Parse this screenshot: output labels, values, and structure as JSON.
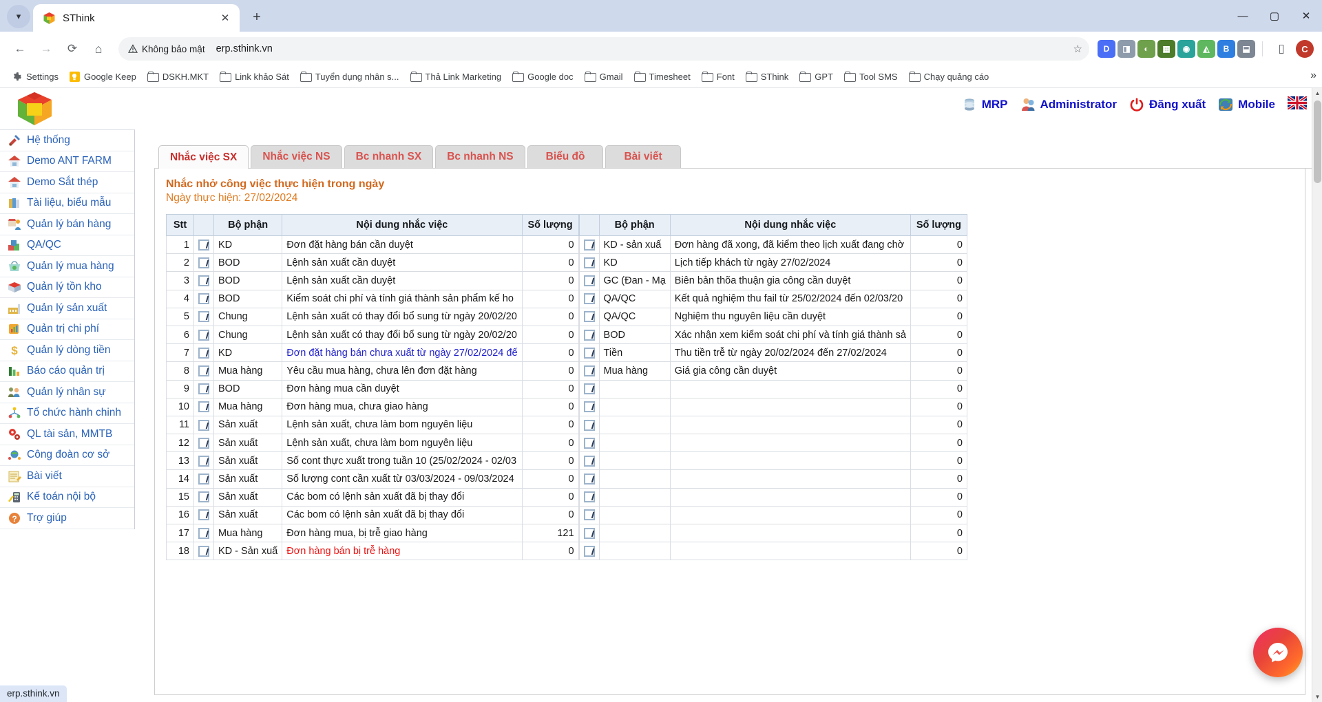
{
  "browser": {
    "tab": {
      "title": "SThink",
      "favicon": "sthink-logo-icon",
      "close": "✕"
    },
    "new_tab_label": "+",
    "window_controls": {
      "minimize": "—",
      "maximize": "▢",
      "close": "✕"
    },
    "nav": {
      "back": "←",
      "forward": "→",
      "reload": "⟳",
      "home": "⌂"
    },
    "omnibox": {
      "security_label": "Không bảo mật",
      "security_icon": "warning-triangle-icon",
      "url": "erp.sthink.vn",
      "star_icon": "☆"
    },
    "extensions": [
      "D",
      "◨",
      "◐",
      "▦",
      "◉",
      "◭",
      "B",
      "⬓"
    ],
    "split_icon": "▯",
    "profile_initial": "C",
    "bookmarks": [
      {
        "label": "Settings",
        "icon": "gear-icon"
      },
      {
        "label": "Google Keep",
        "icon": "keep-icon"
      },
      {
        "label": "DSKH.MKT",
        "icon": "folder-icon"
      },
      {
        "label": "Link khảo Sát",
        "icon": "folder-icon"
      },
      {
        "label": "Tuyển dụng nhân s...",
        "icon": "folder-icon"
      },
      {
        "label": "Thả Link Marketing",
        "icon": "folder-icon"
      },
      {
        "label": "Google doc",
        "icon": "folder-icon"
      },
      {
        "label": "Gmail",
        "icon": "folder-icon"
      },
      {
        "label": "Timesheet",
        "icon": "folder-icon"
      },
      {
        "label": "Font",
        "icon": "folder-icon"
      },
      {
        "label": "SThink",
        "icon": "folder-icon"
      },
      {
        "label": "GPT",
        "icon": "folder-icon"
      },
      {
        "label": "Tool SMS",
        "icon": "folder-icon"
      },
      {
        "label": "Chạy quảng cáo",
        "icon": "folder-icon"
      }
    ],
    "bookmarks_overflow": "»",
    "status_url": "erp.sthink.vn"
  },
  "erp": {
    "header_links": [
      {
        "label": "MRP",
        "icon": "database-icon"
      },
      {
        "label": "Administrator",
        "icon": "user-icon"
      },
      {
        "label": "Đăng xuất",
        "icon": "power-icon"
      },
      {
        "label": "Mobile",
        "icon": "sync-mobile-icon"
      }
    ],
    "language_flag": "uk-flag-icon",
    "sidebar": [
      {
        "label": "Hệ thống",
        "icon": "tools-icon"
      },
      {
        "label": "Demo ANT FARM",
        "icon": "house-icon"
      },
      {
        "label": "Demo Sắt thép",
        "icon": "house-icon"
      },
      {
        "label": "Tài liệu, biểu mẫu",
        "icon": "books-icon"
      },
      {
        "label": "Quản lý bán hàng",
        "icon": "shop-icon"
      },
      {
        "label": "QA/QC",
        "icon": "blocks-icon"
      },
      {
        "label": "Quản lý mua hàng",
        "icon": "basket-icon"
      },
      {
        "label": "Quản lý tồn kho",
        "icon": "box-icon"
      },
      {
        "label": "Quản lý sản xuất",
        "icon": "factory-icon"
      },
      {
        "label": "Quản trị chi phí",
        "icon": "chart-book-icon"
      },
      {
        "label": "Quản lý dòng tiền",
        "icon": "dollar-icon"
      },
      {
        "label": "Báo cáo quản trị",
        "icon": "bar-chart-icon"
      },
      {
        "label": "Quản lý nhân sự",
        "icon": "people-icon"
      },
      {
        "label": "Tổ chức hành chinh",
        "icon": "network-icon"
      },
      {
        "label": "QL tài sản, MMTB",
        "icon": "gears-icon"
      },
      {
        "label": "Công đoàn cơ sở",
        "icon": "union-icon"
      },
      {
        "label": "Bài viết",
        "icon": "note-icon"
      },
      {
        "label": "Kế toán nội bộ",
        "icon": "calculator-icon"
      },
      {
        "label": "Trợ giúp",
        "icon": "help-icon"
      }
    ],
    "tabs": [
      {
        "label": "Nhắc việc SX",
        "active": true
      },
      {
        "label": "Nhắc việc NS",
        "active": false
      },
      {
        "label": "Bc nhanh SX",
        "active": false
      },
      {
        "label": "Bc nhanh NS",
        "active": false
      },
      {
        "label": "Biểu đồ",
        "active": false
      },
      {
        "label": "Bài viết",
        "active": false
      }
    ],
    "panel": {
      "title": "Nhắc nhở công việc thực hiện trong ngày",
      "subtitle": "Ngày thực hiện: 27/02/2024"
    },
    "table_left": {
      "headers": [
        "Stt",
        "",
        "Bộ phận",
        "Nội dung nhắc việc",
        "Số lượng"
      ],
      "rows": [
        {
          "stt": "1",
          "dept": "KD",
          "content": "Đơn đặt hàng bán cần duyệt",
          "qty": "0",
          "style": "normal"
        },
        {
          "stt": "2",
          "dept": "BOD",
          "content": "Lệnh sản xuất cần duyệt",
          "qty": "0",
          "style": "normal"
        },
        {
          "stt": "3",
          "dept": "BOD",
          "content": "Lệnh sản xuất cần duyệt",
          "qty": "0",
          "style": "normal"
        },
        {
          "stt": "4",
          "dept": "BOD",
          "content": "Kiểm soát chi phí và tính giá thành sản phẩm kế ho",
          "qty": "0",
          "style": "normal"
        },
        {
          "stt": "5",
          "dept": "Chung",
          "content": "Lệnh sản xuất có thay đổi bổ sung từ ngày 20/02/20",
          "qty": "0",
          "style": "normal"
        },
        {
          "stt": "6",
          "dept": "Chung",
          "content": "Lệnh sản xuất có thay đổi bổ sung từ ngày 20/02/20",
          "qty": "0",
          "style": "normal"
        },
        {
          "stt": "7",
          "dept": "KD",
          "content": "Đơn đặt hàng bán chưa xuất từ ngày 27/02/2024 đế",
          "qty": "0",
          "style": "blue"
        },
        {
          "stt": "8",
          "dept": "Mua hàng",
          "content": "Yêu cầu mua hàng, chưa lên đơn đặt hàng",
          "qty": "0",
          "style": "normal"
        },
        {
          "stt": "9",
          "dept": "BOD",
          "content": "Đơn hàng mua cần duyệt",
          "qty": "0",
          "style": "normal"
        },
        {
          "stt": "10",
          "dept": "Mua hàng",
          "content": "Đơn hàng mua, chưa giao hàng",
          "qty": "0",
          "style": "normal"
        },
        {
          "stt": "11",
          "dept": "Sản xuất",
          "content": "Lệnh sản xuất, chưa làm bom nguyên liệu",
          "qty": "0",
          "style": "normal"
        },
        {
          "stt": "12",
          "dept": "Sản xuất",
          "content": "Lệnh sản xuất, chưa làm bom nguyên liệu",
          "qty": "0",
          "style": "normal"
        },
        {
          "stt": "13",
          "dept": "Sản xuất",
          "content": "Số cont thực xuất trong tuần 10 (25/02/2024 - 02/03",
          "qty": "0",
          "style": "normal"
        },
        {
          "stt": "14",
          "dept": "Sản xuất",
          "content": "Số lượng cont cần xuất từ 03/03/2024 - 09/03/2024",
          "qty": "0",
          "style": "normal"
        },
        {
          "stt": "15",
          "dept": "Sản xuất",
          "content": "Các bom có lệnh sản xuất đã bị thay đổi",
          "qty": "0",
          "style": "normal"
        },
        {
          "stt": "16",
          "dept": "Sản xuất",
          "content": "Các bom có lệnh sản xuất đã bị thay đổi",
          "qty": "0",
          "style": "normal"
        },
        {
          "stt": "17",
          "dept": "Mua hàng",
          "content": "Đơn hàng mua, bị trễ giao hàng",
          "qty": "121",
          "style": "normal"
        },
        {
          "stt": "18",
          "dept": "KD - Sản xuấ",
          "content": "Đơn hàng bán bị trễ hàng",
          "qty": "0",
          "style": "red"
        }
      ]
    },
    "table_right": {
      "headers": [
        "",
        "Bộ phận",
        "Nội dung nhắc việc",
        "Số lượng"
      ],
      "rows": [
        {
          "dept": "KD - sản xuấ",
          "content": "Đơn hàng đã xong, đã kiểm theo lịch xuất đang chờ",
          "qty": "0",
          "style": "normal"
        },
        {
          "dept": "KD",
          "content": "Lịch tiếp khách từ ngày 27/02/2024",
          "qty": "0",
          "style": "normal"
        },
        {
          "dept": "GC (Đan - Mạ",
          "content": "Biên bản thõa thuận gia công cần duyệt",
          "qty": "0",
          "style": "normal"
        },
        {
          "dept": "QA/QC",
          "content": "Kết quả nghiệm thu fail từ 25/02/2024 đến 02/03/20",
          "qty": "0",
          "style": "normal"
        },
        {
          "dept": "QA/QC",
          "content": "Nghiệm thu nguyên liệu cần duyệt",
          "qty": "0",
          "style": "normal"
        },
        {
          "dept": "BOD",
          "content": "Xác nhận xem kiểm soát chi phí và tính giá thành sả",
          "qty": "0",
          "style": "normal"
        },
        {
          "dept": "Tiền",
          "content": "Thu tiền trễ từ ngày 20/02/2024 đến 27/02/2024",
          "qty": "0",
          "style": "normal"
        },
        {
          "dept": "Mua hàng",
          "content": "Giá gia công cần duyệt",
          "qty": "0",
          "style": "normal"
        },
        {
          "dept": "",
          "content": "",
          "qty": "0",
          "style": "normal"
        },
        {
          "dept": "",
          "content": "",
          "qty": "0",
          "style": "normal"
        },
        {
          "dept": "",
          "content": "",
          "qty": "0",
          "style": "normal"
        },
        {
          "dept": "",
          "content": "",
          "qty": "0",
          "style": "normal"
        },
        {
          "dept": "",
          "content": "",
          "qty": "0",
          "style": "normal"
        },
        {
          "dept": "",
          "content": "",
          "qty": "0",
          "style": "normal"
        },
        {
          "dept": "",
          "content": "",
          "qty": "0",
          "style": "normal"
        },
        {
          "dept": "",
          "content": "",
          "qty": "0",
          "style": "normal"
        },
        {
          "dept": "",
          "content": "",
          "qty": "0",
          "style": "normal"
        },
        {
          "dept": "",
          "content": "",
          "qty": "0",
          "style": "normal"
        }
      ]
    },
    "chat_fab_icon": "messenger-icon"
  },
  "colors": {
    "tab_text": "#d9534f",
    "panel_title": "#d2691e",
    "sidebar_link": "#2a62b8",
    "header_link": "#1111cc",
    "grid_header_bg": "#e8eff7"
  }
}
